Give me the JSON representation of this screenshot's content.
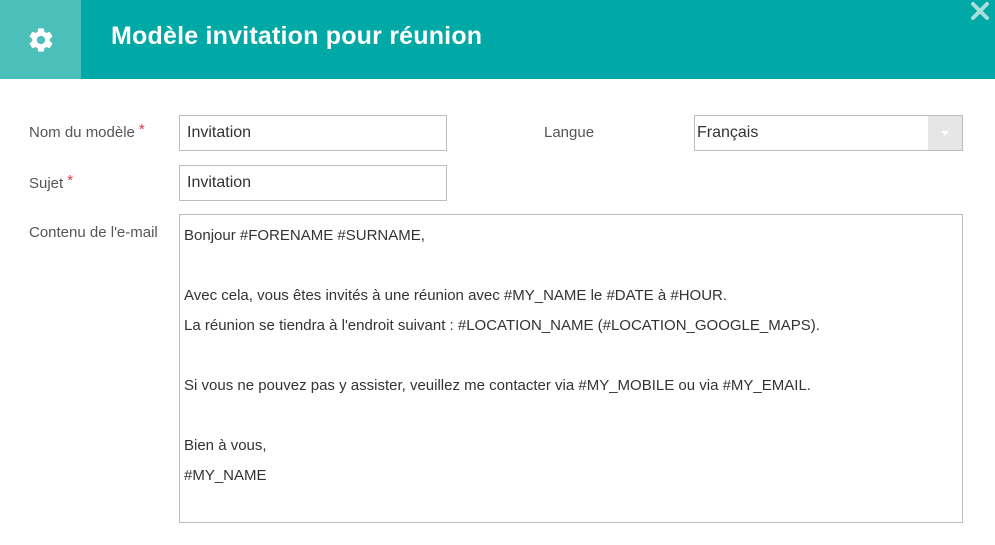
{
  "header": {
    "title": "Modèle invitation pour réunion",
    "settings_icon": "gear-icon",
    "close_icon": "close-icon",
    "accent_color": "#00a9a5"
  },
  "form": {
    "name_label": "Nom du modèle",
    "name_required": "*",
    "name_value": "Invitation",
    "subject_label": "Sujet",
    "subject_required": "*",
    "subject_value": "Invitation",
    "language_label": "Langue",
    "language_value": "Français",
    "content_label": "Contenu de l'e-mail",
    "content_lines": [
      "Bonjour #FORENAME #SURNAME,",
      "",
      "Avec cela, vous êtes invités à une réunion avec #MY_NAME le #DATE à #HOUR.",
      "La réunion se tiendra à l'endroit suivant : #LOCATION_NAME (#LOCATION_GOOGLE_MAPS).",
      "",
      "Si vous ne pouvez pas y assister, veuillez me contacter via #MY_MOBILE ou via #MY_EMAIL.",
      "",
      "Bien à vous,",
      "#MY_NAME"
    ]
  }
}
